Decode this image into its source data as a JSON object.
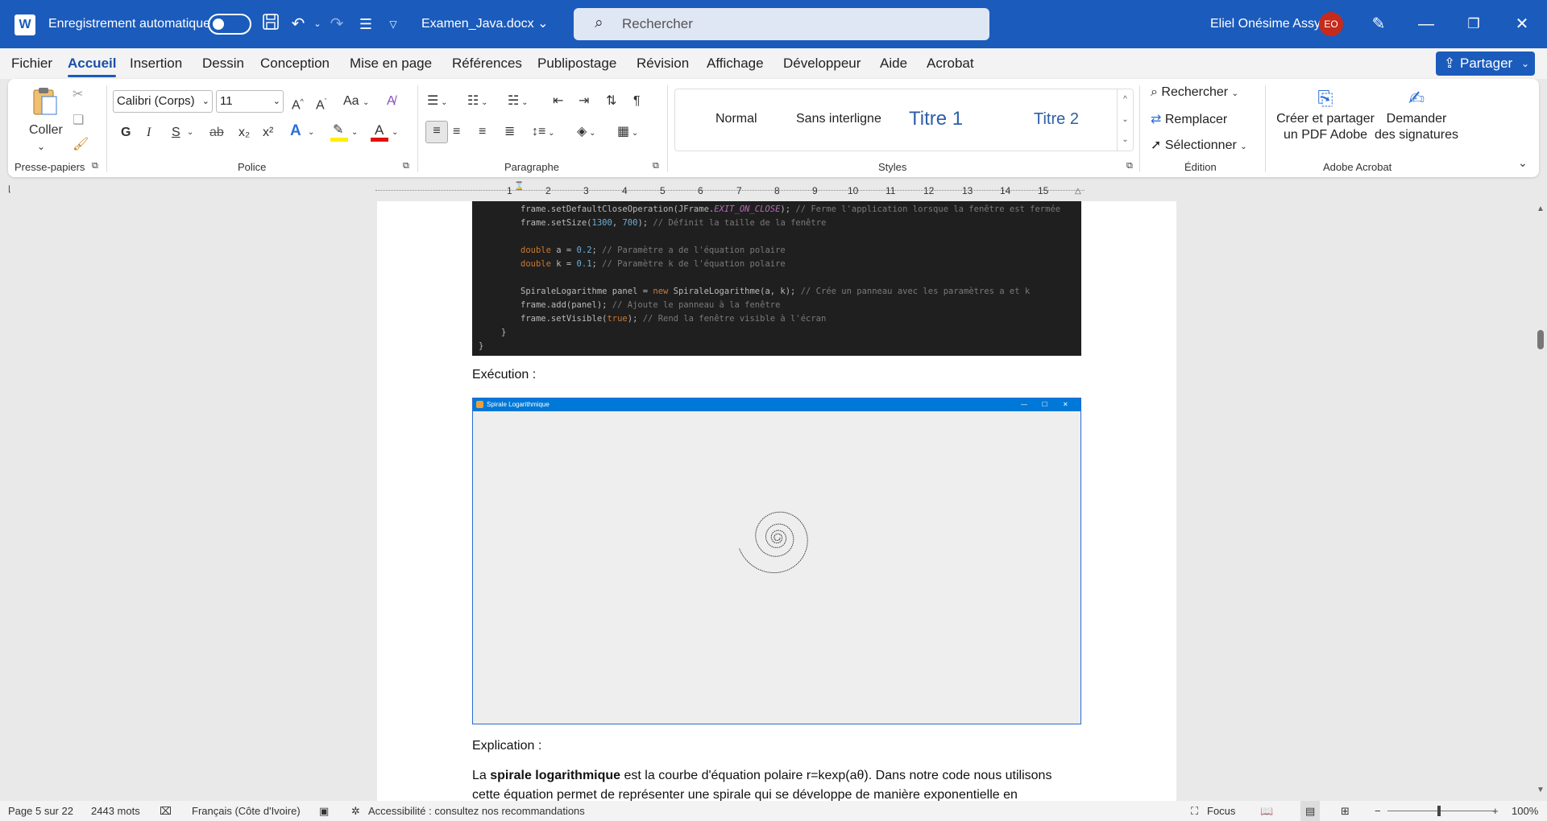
{
  "titlebar": {
    "autosave_label": "Enregistrement automatique",
    "doc_name": "Examen_Java.docx",
    "search_placeholder": "Rechercher",
    "user_name": "Eliel Onésime Assy",
    "user_initials": "EO"
  },
  "menu": {
    "tabs": [
      "Fichier",
      "Accueil",
      "Insertion",
      "Dessin",
      "Conception",
      "Mise en page",
      "Références",
      "Publipostage",
      "Révision",
      "Affichage",
      "Développeur",
      "Aide",
      "Acrobat"
    ],
    "active_tab": "Accueil",
    "share_label": "Partager"
  },
  "ribbon": {
    "clipboard": {
      "paste_label": "Coller",
      "group_label": "Presse-papiers"
    },
    "font": {
      "font_name": "Calibri (Corps)",
      "font_size": "11",
      "case_label": "Aa",
      "group_label": "Police",
      "buttons": [
        "G",
        "I",
        "S",
        "ab",
        "x₂",
        "x²"
      ]
    },
    "paragraph": {
      "group_label": "Paragraphe"
    },
    "styles": {
      "items": [
        "Normal",
        "Sans interligne",
        "Titre 1",
        "Titre 2"
      ],
      "group_label": "Styles"
    },
    "editing": {
      "find_label": "Rechercher",
      "replace_label": "Remplacer",
      "select_label": "Sélectionner",
      "group_label": "Édition"
    },
    "acrobat": {
      "create_label_1": "Créer et partager",
      "create_label_2": "un PDF Adobe",
      "sign_label_1": "Demander",
      "sign_label_2": "des signatures",
      "group_label": "Adobe Acrobat"
    }
  },
  "ruler": {
    "numbers": [
      "1",
      "2",
      "3",
      "4",
      "5",
      "6",
      "7",
      "8",
      "9",
      "10",
      "11",
      "12",
      "13",
      "14",
      "15"
    ]
  },
  "document": {
    "code_lines": [
      {
        "code": "frame.setDefaultCloseOperation(JFrame.",
        "italic": "EXIT_ON_CLOSE",
        "rest": "); ",
        "comment": "// Ferme l'application lorsque la fenêtre est fermée"
      },
      {
        "code": "frame.setSize(",
        "n1": "1300",
        "mid": ", ",
        "n2": "700",
        "rest": "); ",
        "comment": "// Définit la taille de la fenêtre"
      },
      {
        "kw": "double",
        "code": " a = ",
        "n1": "0.2",
        "rest": "; ",
        "comment": "// Paramètre a de l'équation polaire"
      },
      {
        "kw": "double",
        "code": " k = ",
        "n1": "0.1",
        "rest": "; ",
        "comment": "// Paramètre k de l'équation polaire"
      },
      {
        "code": "SpiraleLogarithme panel = ",
        "kw": "new",
        "rest": " SpiraleLogarithme(a, k); ",
        "comment": "// Crée un panneau avec les paramètres a et k"
      },
      {
        "code": "frame.add(panel); ",
        "comment": "// Ajoute le panneau à la fenêtre"
      },
      {
        "code": "frame.setVisible(",
        "kw": "true",
        "rest": "); ",
        "comment": "// Rend la fenêtre visible à l'écran"
      }
    ],
    "heading_execution": "Exécution :",
    "window_title": "Spirale Logarithmique",
    "heading_explication": "Explication :",
    "para_prefix": "La ",
    "para_bold": "spirale logarithmique",
    "para_rest": " est la courbe d'équation polaire r=kexp(aθ). Dans notre code nous utilisons",
    "para_line2": "cette équation permet de représenter une spirale qui se développe de manière exponentielle en"
  },
  "status": {
    "page": "Page 5 sur 22",
    "words": "2443 mots",
    "language": "Français (Côte d'Ivoire)",
    "accessibility": "Accessibilité : consultez nos recommandations",
    "focus": "Focus",
    "zoom": "100%"
  },
  "colors": {
    "brand": "#1b5bbc",
    "active_tab": "#1b4fa8",
    "window_title": "#0078d7"
  }
}
